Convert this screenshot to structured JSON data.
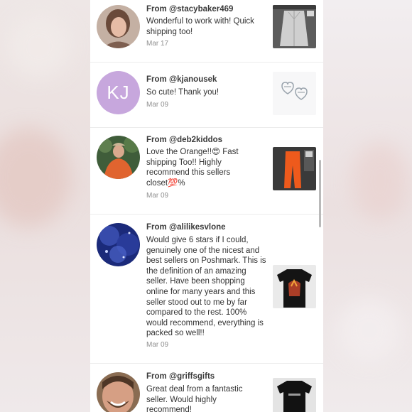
{
  "reviews": [
    {
      "from": "From @stacybaker469",
      "text": "Wonderful to work with! Quick shipping too!",
      "date": "Mar 17",
      "avatar_type": "photo",
      "thumb": "light-jacket-photo"
    },
    {
      "from": "From @kjanousek",
      "text": "So cute! Thank you!",
      "date": "Mar 09",
      "avatar_type": "initials",
      "initials": "KJ",
      "avatar_color": "#c7a7dd",
      "thumb": "heart-earrings-photo"
    },
    {
      "from": "From @deb2kiddos",
      "text": "Love the Orange!!😍 Fast shipping Too!! Highly recommend this sellers closet💯%",
      "date": "Mar 09",
      "avatar_type": "photo",
      "thumb": "orange-pants-photo"
    },
    {
      "from": "From @alilikesvlone",
      "text": "Would give 6 stars if I could, genuinely one of the nicest and best sellers on Poshmark. This is the definition of an amazing seller. Have been shopping online for many years and this seller stood out to me by far compared to the rest. 100% would recommend, everything is packed so well!!",
      "date": "Mar 09",
      "avatar_type": "photo",
      "thumb": "black-graphic-tee-photo"
    },
    {
      "from": "From @griffsgifts",
      "text": "Great deal from a fantastic seller. Would highly recommend!",
      "date": "",
      "avatar_type": "photo",
      "thumb": "black-shirt-photo"
    }
  ]
}
